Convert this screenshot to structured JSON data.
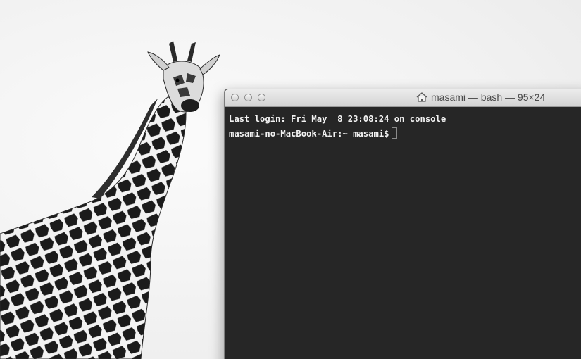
{
  "wallpaper": {
    "subject": "giraffe-icon"
  },
  "terminal": {
    "title": "masami — bash — 95×24",
    "lines": [
      "Last login: Fri May  8 23:08:24 on console",
      "masami-no-MacBook-Air:~ masami$"
    ]
  }
}
